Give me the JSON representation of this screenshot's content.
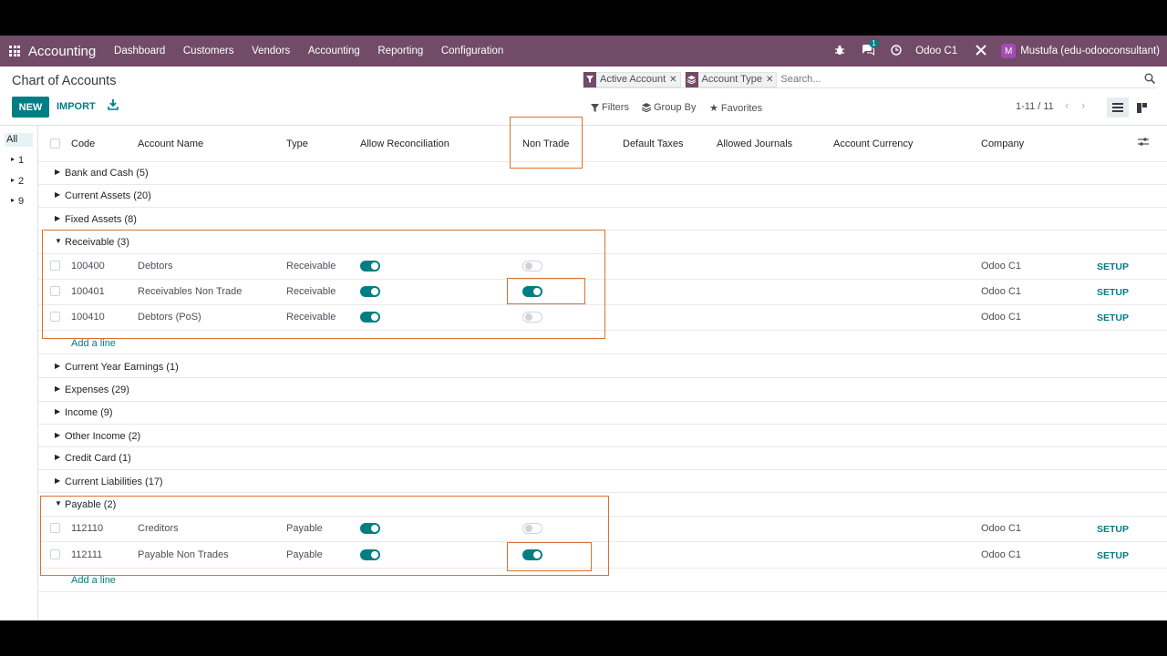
{
  "navbar": {
    "app_name": "Accounting",
    "menu": [
      "Dashboard",
      "Customers",
      "Vendors",
      "Accounting",
      "Reporting",
      "Configuration"
    ],
    "message_count": "1",
    "company": "Odoo C1",
    "avatar_letter": "M",
    "user": "Mustufa (edu-odooconsultant)"
  },
  "page": {
    "title": "Chart of Accounts",
    "new_label": "NEW",
    "import_label": "IMPORT"
  },
  "search": {
    "facets": [
      "Active Account",
      "Account Type"
    ],
    "placeholder": "Search...",
    "filters_label": "Filters",
    "group_by_label": "Group By",
    "favorites_label": "Favorites",
    "pager": "1-11 / 11"
  },
  "side_panel": {
    "all_label": "All",
    "items": [
      "1",
      "2",
      "9"
    ]
  },
  "table": {
    "columns": [
      "Code",
      "Account Name",
      "Type",
      "Allow Reconciliation",
      "Non Trade",
      "Default Taxes",
      "Allowed Journals",
      "Account Currency",
      "Company"
    ],
    "groups_before": [
      "Bank and Cash (5)",
      "Current Assets (20)",
      "Fixed Assets (8)"
    ],
    "receivable_group": "Receivable (3)",
    "receivable_rows": [
      {
        "code": "100400",
        "name": "Debtors",
        "type": "Receivable",
        "reconcile": true,
        "non_trade": false,
        "company": "Odoo C1",
        "action": "SETUP"
      },
      {
        "code": "100401",
        "name": "Receivables Non Trade",
        "type": "Receivable",
        "reconcile": true,
        "non_trade": true,
        "company": "Odoo C1",
        "action": "SETUP"
      },
      {
        "code": "100410",
        "name": "Debtors (PoS)",
        "type": "Receivable",
        "reconcile": true,
        "non_trade": false,
        "company": "Odoo C1",
        "action": "SETUP"
      }
    ],
    "add_line": "Add a line",
    "groups_middle": [
      "Current Year Earnings (1)",
      "Expenses (29)",
      "Income (9)",
      "Other Income (2)",
      "Credit Card (1)",
      "Current Liabilities (17)"
    ],
    "payable_group": "Payable (2)",
    "payable_rows": [
      {
        "code": "112110",
        "name": "Creditors",
        "type": "Payable",
        "reconcile": true,
        "non_trade": false,
        "company": "Odoo C1",
        "action": "SETUP"
      },
      {
        "code": "112111",
        "name": "Payable Non Trades",
        "type": "Payable",
        "reconcile": true,
        "non_trade": true,
        "company": "Odoo C1",
        "action": "SETUP"
      }
    ]
  },
  "colors": {
    "brand": "#714b67",
    "accent": "#017e84",
    "highlight": "#d9722e"
  }
}
